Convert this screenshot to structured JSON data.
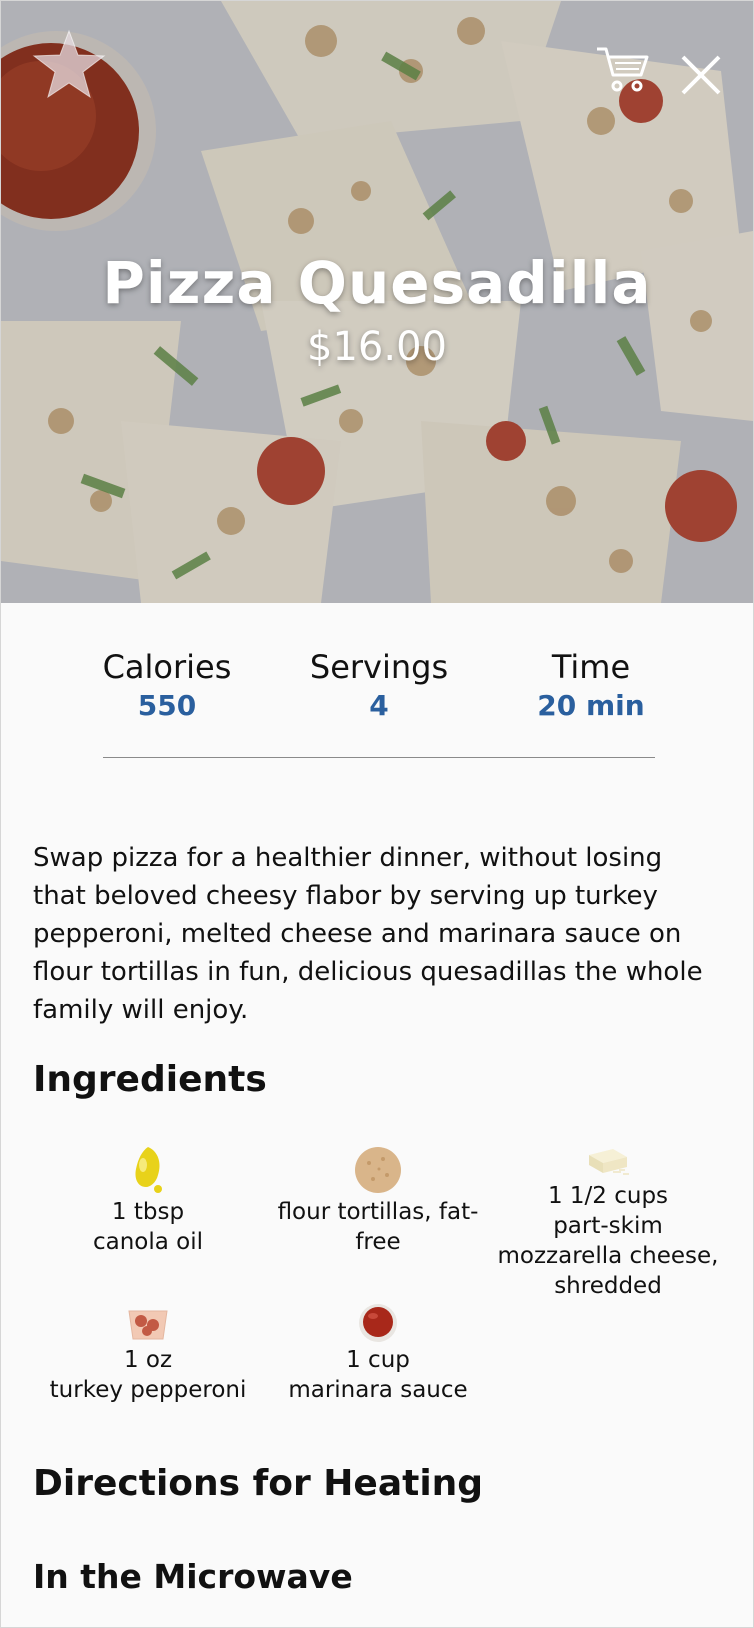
{
  "recipe": {
    "title": "Pizza Quesadilla",
    "price": "$16.00"
  },
  "actions": {
    "favorite_icon": "star-icon",
    "cart_icon": "cart-icon",
    "close_icon": "close-icon"
  },
  "stats": [
    {
      "label": "Calories",
      "value": "550"
    },
    {
      "label": "Servings",
      "value": "4"
    },
    {
      "label": "Time",
      "value": "20 min"
    }
  ],
  "description": "Swap pizza for a healthier dinner, without losing that beloved cheesy flabor by serving up turkey pepperoni, melted cheese and marinara sauce on flour tortillas in fun, delicious quesadillas the whole family will enjoy.",
  "ingredients_heading": "Ingredients",
  "ingredients": [
    {
      "qty": "1 tbsp",
      "name": "canola oil",
      "icon": "oil-icon"
    },
    {
      "qty": "",
      "name": "flour tortillas, fat-free",
      "icon": "tortilla-icon"
    },
    {
      "qty": "1 1/2 cups",
      "name": "part-skim mozzarella cheese, shredded",
      "icon": "cheese-icon"
    },
    {
      "qty": "1 oz",
      "name": "turkey pepperoni",
      "icon": "pepperoni-icon"
    },
    {
      "qty": "1 cup",
      "name": "marinara sauce",
      "icon": "sauce-icon"
    }
  ],
  "directions_heading": "Directions for Heating",
  "microwave_heading": "In the Microwave",
  "colors": {
    "accent_blue": "#2a5f9e",
    "background": "#fafafa",
    "text": "#111111"
  }
}
